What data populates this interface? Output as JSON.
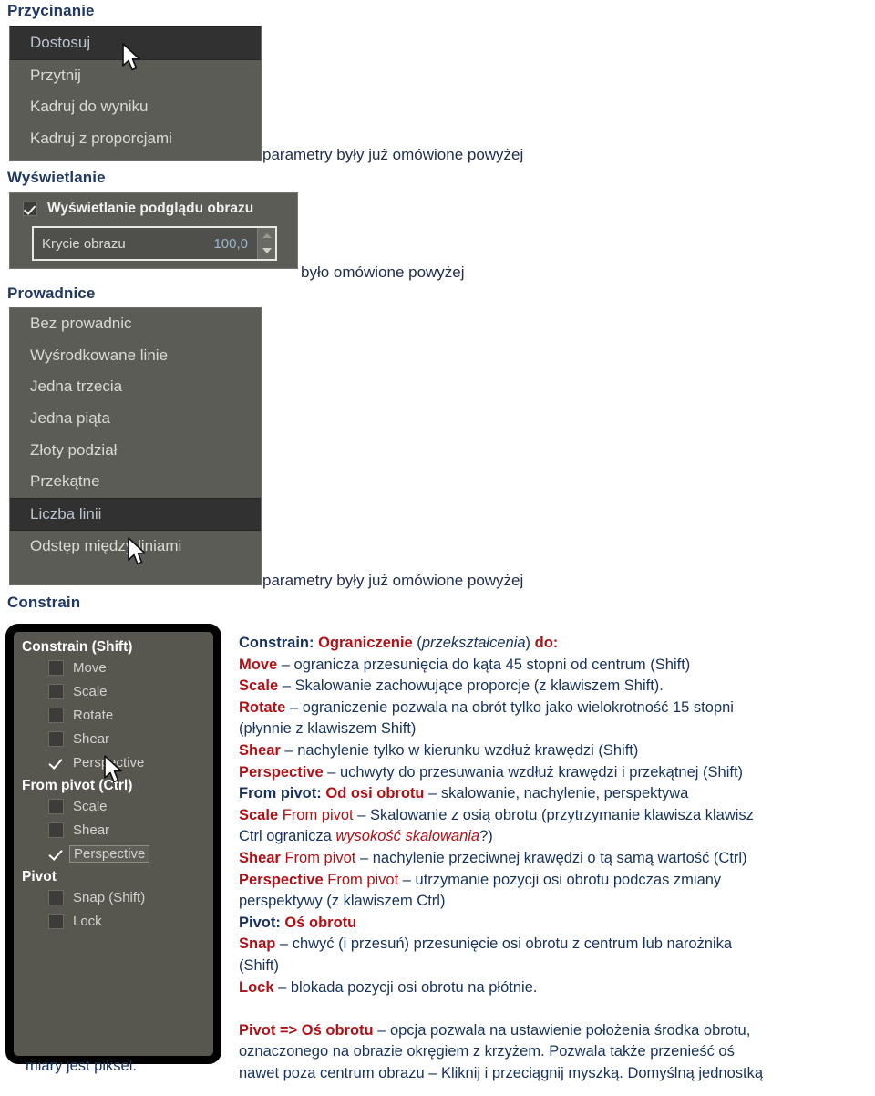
{
  "sections": {
    "crop": {
      "heading": "Przycinanie",
      "items": [
        {
          "label": "Dostosuj",
          "selected": true
        },
        {
          "label": "Przytnij",
          "selected": false
        },
        {
          "label": "Kadruj do wyniku",
          "selected": false
        },
        {
          "label": "Kadruj z proporcjami",
          "selected": false
        }
      ],
      "note": "parametry były już omówione powyżej"
    },
    "display": {
      "heading": "Wyświetlanie",
      "checkbox": {
        "label": "Wyświetlanie podglądu obrazu",
        "checked": true
      },
      "spinner": {
        "label": "Krycie obrazu",
        "value": "100,0"
      },
      "note": "było omówione powyżej"
    },
    "guides": {
      "heading": "Prowadnice",
      "items": [
        {
          "label": "Bez prowadnic",
          "selected": false
        },
        {
          "label": "Wyśrodkowane linie",
          "selected": false
        },
        {
          "label": "Jedna trzecia",
          "selected": false
        },
        {
          "label": "Jedna piąta",
          "selected": false
        },
        {
          "label": "Złoty podział",
          "selected": false
        },
        {
          "label": "Przekątne",
          "selected": false
        },
        {
          "label": "Liczba linii",
          "selected": true
        },
        {
          "label": "Odstęp między liniami",
          "selected": false
        }
      ],
      "note": "parametry były już omówione powyżej"
    },
    "constrain": {
      "heading": "Constrain",
      "groups": [
        {
          "title": "Constrain  (Shift)",
          "rows": [
            {
              "label": "Move",
              "checked": false,
              "focus": false
            },
            {
              "label": "Scale",
              "checked": false,
              "focus": false
            },
            {
              "label": "Rotate",
              "checked": false,
              "focus": false
            },
            {
              "label": "Shear",
              "checked": false,
              "focus": false
            },
            {
              "label": "Perspective",
              "checked": true,
              "focus": false
            }
          ]
        },
        {
          "title": "From pivot  (Ctrl)",
          "rows": [
            {
              "label": "Scale",
              "checked": false,
              "focus": false
            },
            {
              "label": "Shear",
              "checked": false,
              "focus": false
            },
            {
              "label": "Perspective",
              "checked": true,
              "focus": true
            }
          ]
        },
        {
          "title": "Pivot",
          "rows": [
            {
              "label": "Snap  (Shift)",
              "checked": false,
              "focus": false
            },
            {
              "label": "Lock",
              "checked": false,
              "focus": false
            }
          ]
        }
      ]
    }
  },
  "description": {
    "l1_a": "Constrain: ",
    "l1_b": "Ograniczenie",
    "l1_c": " (",
    "l1_d": "przekształcenia",
    "l1_e": ") ",
    "l1_f": "do:",
    "l2_a": "Move",
    "l2_b": " – ogranicza przesunięcia do kąta  45 stopni od centrum (Shift)",
    "l3_a": "Scale",
    "l3_b": " – Skalowanie zachowujące proporcje (z klawiszem Shift).",
    "l4_a": "Rotate",
    "l4_b": " – ograniczenie pozwala na obrót tylko jako wielokrotność 15 stopni",
    "l5": "(płynnie z klawiszem Shift)",
    "l6_a": "Shear",
    "l6_b": " – nachylenie tylko w kierunku wzdłuż krawędzi (Shift)",
    "l7_a": "Perspective",
    "l7_b": " – uchwyty do przesuwania wzdłuż krawędzi i przekątnej (Shift)",
    "l8_a": "From pivot: ",
    "l8_b": " Od osi obrotu",
    "l8_c": " – skalowanie, nachylenie, perspektywa",
    "l9_a": "Scale",
    "l9_b": " From pivot",
    "l9_c": " – Skalowanie z osią obrotu (przytrzymanie klawisza klawisz",
    "l10_a": "Ctrl ogranicza ",
    "l10_b": "wysokość skalowania",
    "l10_c": "?)",
    "l11_a": "Shear",
    "l11_b": " From pivot",
    "l11_c": " – nachylenie przeciwnej krawędzi o tą samą wartość (Ctrl)",
    "l12_a": "Perspective",
    "l12_b": " From pivot",
    "l12_c": " – utrzymanie pozycji osi obrotu podczas zmiany",
    "l13": "perspektywy (z klawiszem Ctrl)",
    "l14_a": "Pivot: ",
    "l14_b": " Oś obrotu",
    "l15_a": "Snap",
    "l15_b": " – chwyć (i przesuń) przesunięcie osi obrotu z centrum lub narożnika",
    "l16": "(Shift)",
    "l17_a": "Lock",
    "l17_b": " – blokada pozycji osi obrotu na płótnie.",
    "l18_a": "Pivot => Oś obrotu",
    "l18_b": " – opcja pozwala na ustawienie położenia środka obrotu,",
    "l19": "oznaczonego na obrazie okręgiem z krzyżem. Pozwala także przenieść oś",
    "l20": "nawet poza centrum obrazu – Kliknij i przeciągnij myszką. Domyślną jednostką",
    "l21": "miary jest piksel."
  },
  "colors": {
    "heading_navy": "#1f3864",
    "body_navy": "#17325c",
    "accent_red": "#b01116",
    "panel_gray": "#5c5c57",
    "panel_selected": "#313131"
  }
}
